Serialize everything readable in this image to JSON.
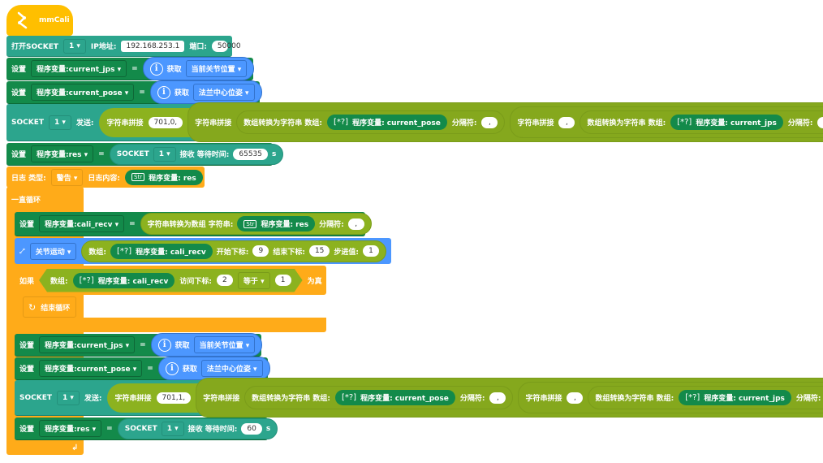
{
  "hat": {
    "label": "mmCali"
  },
  "open_socket": {
    "label": "打开SOCKET",
    "socket_id": "1",
    "ip_label": "IP地址:",
    "ip": "192.168.253.1",
    "port_label": "端口:",
    "port": "50000"
  },
  "set1": {
    "set": "设置",
    "var": "程序变量:current_jps",
    "eq": "=",
    "get": "获取",
    "option": "当前关节位置"
  },
  "set2": {
    "set": "设置",
    "var": "程序变量:current_pose",
    "eq": "=",
    "get": "获取",
    "option": "法兰中心位姿"
  },
  "send1": {
    "socket": "SOCKET",
    "socket_id": "1",
    "send": "发送:",
    "concat": "字符串拼接",
    "prefix": "701,0,",
    "concat2": "字符串拼接",
    "arr2str": "数组转换为字符串 数组:",
    "var_pose": "程序变量: current_pose",
    "sep_label": "分隔符:",
    "sep": ",",
    "concat3": "字符串拼接",
    "comma": ",",
    "arr2str2": "数组转换为字符串 数组:",
    "var_jps": "程序变量: current_jps",
    "sep_label2": "分隔符:",
    "sep2": ","
  },
  "recv1": {
    "set": "设置",
    "var": "程序变量:res",
    "eq": "=",
    "socket": "SOCKET",
    "socket_id": "1",
    "recv": "接收 等待时间:",
    "timeout": "65535",
    "unit": "s"
  },
  "log": {
    "type_label": "日志 类型:",
    "type": "警告",
    "content_label": "日志内容:",
    "var": "程序变量: res",
    "str_icon": "Str"
  },
  "loop": {
    "label": "一直循环"
  },
  "set_cali": {
    "set": "设置",
    "var": "程序变量:cali_recv",
    "eq": "=",
    "func": "字符串转换为数组 字符串:",
    "var_res": "程序变量: res",
    "sep_label": "分隔符:",
    "sep": ","
  },
  "joint_move": {
    "mode": "关节运动",
    "arr_label": "数组:",
    "var": "程序变量: cali_recv",
    "start_label": "开始下标:",
    "start": "9",
    "end_label": "结束下标:",
    "end": "15",
    "step_label": "步进值:",
    "step": "1"
  },
  "if_block": {
    "if": "如果",
    "arr_label": "数组:",
    "var": "程序变量: cali_recv",
    "index_label": "访问下标:",
    "index": "2",
    "op": "等于",
    "value": "1",
    "then": "为真"
  },
  "break": {
    "label": "结束循环"
  },
  "set3": {
    "set": "设置",
    "var": "程序变量:current_jps",
    "eq": "=",
    "get": "获取",
    "option": "当前关节位置"
  },
  "set4": {
    "set": "设置",
    "var": "程序变量:current_pose",
    "eq": "=",
    "get": "获取",
    "option": "法兰中心位姿"
  },
  "send2": {
    "socket": "SOCKET",
    "socket_id": "1",
    "send": "发送:",
    "concat": "字符串拼接",
    "prefix": "701,1,",
    "concat2": "字符串拼接",
    "arr2str": "数组转换为字符串 数组:",
    "var_pose": "程序变量: current_pose",
    "sep_label": "分隔符:",
    "sep": ",",
    "concat3": "字符串拼接",
    "comma": ",",
    "arr2str2": "数组转换为字符串 数组:",
    "var_jps": "程序变量: current_jps",
    "sep_label2": "分隔符:",
    "sep2": ","
  },
  "recv2": {
    "set": "设置",
    "var": "程序变量:res",
    "eq": "=",
    "socket": "SOCKET",
    "socket_id": "1",
    "recv": "接收 等待时间:",
    "timeout": "60",
    "unit": "s"
  },
  "loop_end": {
    "arrow": "↲"
  },
  "icons": {
    "array": "[*?]",
    "info": "i"
  }
}
